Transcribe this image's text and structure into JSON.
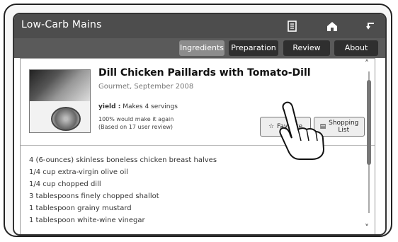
{
  "app": {
    "title": "Low-Carb Mains"
  },
  "topbar_icons": [
    {
      "name": "shopping-list-icon",
      "glyph": "▯"
    },
    {
      "name": "home-icon",
      "glyph": "⌂"
    },
    {
      "name": "back-icon",
      "glyph": "↩"
    }
  ],
  "tabs": [
    {
      "label": "Ingredients",
      "active": true
    },
    {
      "label": "Preparation",
      "active": false
    },
    {
      "label": "Review",
      "active": false
    },
    {
      "label": "About",
      "active": false
    }
  ],
  "recipe": {
    "title": "Dill Chicken Paillards with Tomato-Dill",
    "source": "Gourmet, September 2008",
    "yield_label": "yield :",
    "yield_text": "Makes 4 servings",
    "rating_line1": "100% would make it again",
    "rating_line2": "(Based on 17 user review)"
  },
  "actions": {
    "favorite_label": "Favorite",
    "shopping_list_label_line1": "Shopping",
    "shopping_list_label_line2": "List"
  },
  "ingredients": [
    "4 (6-ounces) skinless boneless chicken breast halves",
    "1/4 cup extra-virgin olive oil",
    "1/4 cup chopped dill",
    "3 tablespoons finely chopped shallot",
    "1 tablespoon grainy mustard",
    "1 tablespoon white-wine vinegar"
  ]
}
